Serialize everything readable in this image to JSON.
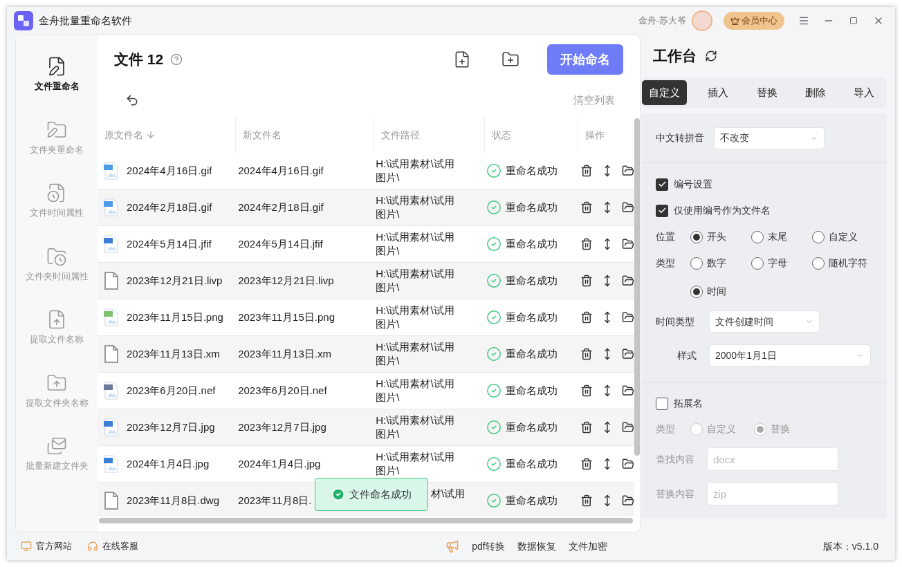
{
  "window": {
    "title": "金舟批量重命名软件",
    "user": "金舟-苏大爷",
    "vip_button": "会员中心"
  },
  "sidebar": {
    "items": [
      {
        "label": "文件重命名",
        "kind": "file-pen",
        "selected": true
      },
      {
        "label": "文件夹重命名",
        "kind": "folder-pen",
        "selected": false
      },
      {
        "label": "文件时间属性",
        "kind": "file-clock",
        "selected": false
      },
      {
        "label": "文件夹时间属性",
        "kind": "folder-clock",
        "selected": false
      },
      {
        "label": "提取文件名称",
        "kind": "file-up",
        "selected": false
      },
      {
        "label": "提取文件夹名称",
        "kind": "folder-up",
        "selected": false
      },
      {
        "label": "批量新建文件夹",
        "kind": "mails",
        "selected": false
      }
    ]
  },
  "files": {
    "title": "文件 12",
    "start_button": "开始命名",
    "clear_button": "清空列表",
    "columns": [
      "原文件名",
      "新文件名",
      "文件路径",
      "状态",
      "操作"
    ],
    "rows": [
      {
        "kind": "image",
        "color": "#4a9be8",
        "original": "2024年4月16日.gif",
        "new": "2024年4月16日.gif",
        "path": "H:\\试用素材\\试用图片\\",
        "status": "重命名成功"
      },
      {
        "kind": "image",
        "color": "#4a9be8",
        "original": "2024年2月18日.gif",
        "new": "2024年2月18日.gif",
        "path": "H:\\试用素材\\试用图片\\",
        "status": "重命名成功"
      },
      {
        "kind": "image",
        "color": "#3b7fd9",
        "original": "2024年5月14日.jfif",
        "new": "2024年5月14日.jfif",
        "path": "H:\\试用素材\\试用图片\\",
        "status": "重命名成功"
      },
      {
        "kind": "plain",
        "color": "#9a9a9a",
        "original": "2023年12月21日.livp",
        "new": "2023年12月21日.livp",
        "path": "H:\\试用素材\\试用图片\\",
        "status": "重命名成功"
      },
      {
        "kind": "image",
        "color": "#7cc36f",
        "original": "2023年11月15日.png",
        "new": "2023年11月15日.png",
        "path": "H:\\试用素材\\试用图片\\",
        "status": "重命名成功"
      },
      {
        "kind": "plain",
        "color": "#9a9a9a",
        "original": "2023年11月13日.xm",
        "new": "2023年11月13日.xm",
        "path": "H:\\试用素材\\试用图片\\",
        "status": "重命名成功"
      },
      {
        "kind": "image",
        "color": "#6b7a99",
        "original": "2023年6月20日.nef",
        "new": "2023年6月20日.nef",
        "path": "H:\\试用素材\\试用图片\\",
        "status": "重命名成功"
      },
      {
        "kind": "image",
        "color": "#3b7fd9",
        "original": "2023年12月7日.jpg",
        "new": "2023年12月7日.jpg",
        "path": "H:\\试用素材\\试用图片\\",
        "status": "重命名成功"
      },
      {
        "kind": "image",
        "color": "#3b7fd9",
        "original": "2024年1月4日.jpg",
        "new": "2024年1月4日.jpg",
        "path": "H:\\试用素材\\试用图片\\",
        "status": "重命名成功"
      },
      {
        "kind": "plain",
        "color": "#9a9a9a",
        "original": "2023年11月8日.dwg",
        "new": "2023年11月8日.",
        "path": "材\\试用",
        "status": "重命名成功"
      }
    ]
  },
  "toast": "文件命名成功",
  "workbench": {
    "title": "工作台",
    "tabs": [
      {
        "label": "自定义",
        "selected": true
      },
      {
        "label": "插入",
        "selected": false
      },
      {
        "label": "替换",
        "selected": false
      },
      {
        "label": "删除",
        "selected": false
      },
      {
        "label": "导入",
        "selected": false
      }
    ],
    "pinyin": {
      "label": "中文转拼音",
      "value": "不改变"
    },
    "numbering": {
      "label": "编号设置",
      "checked": true
    },
    "only_number": {
      "label": "仅使用编号作为文件名",
      "checked": true
    },
    "position": {
      "label": "位置",
      "options": [
        {
          "label": "开头",
          "selected": true
        },
        {
          "label": "末尾",
          "selected": false
        },
        {
          "label": "自定义",
          "selected": false
        }
      ]
    },
    "type": {
      "label": "类型",
      "options": [
        {
          "label": "数字",
          "selected": false
        },
        {
          "label": "字母",
          "selected": false
        },
        {
          "label": "随机字符",
          "selected": false
        },
        {
          "label": "时间",
          "selected": true
        }
      ]
    },
    "time_type": {
      "label": "时间类型",
      "value": "文件创建时间"
    },
    "style": {
      "label": "样式",
      "value": "2000年1月1日"
    },
    "extension": {
      "label": "拓展名",
      "checked": false,
      "disabled": true,
      "type_label": "类型",
      "options": [
        {
          "label": "自定义",
          "selected": false
        },
        {
          "label": "替换",
          "selected": true
        }
      ],
      "find": {
        "label": "查找内容",
        "placeholder": "docx"
      },
      "replace": {
        "label": "替换内容",
        "placeholder": "zip"
      }
    }
  },
  "footer": {
    "left": [
      "官方网站",
      "在线客服"
    ],
    "links": [
      "pdf转换",
      "数据恢复",
      "文件加密"
    ],
    "version": "版本：v5.1.0"
  }
}
